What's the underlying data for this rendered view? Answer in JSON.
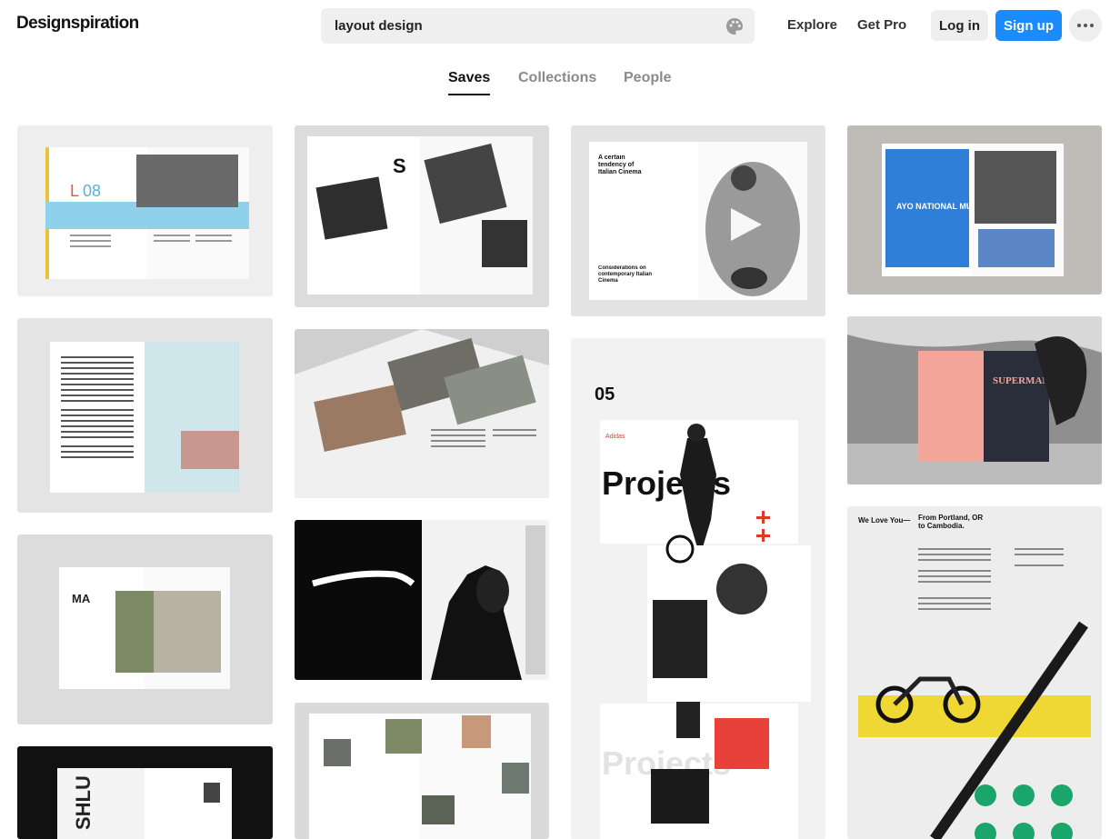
{
  "header": {
    "logo": "Designspiration",
    "search_value": "layout design",
    "nav": {
      "explore": "Explore",
      "get_pro": "Get Pro"
    },
    "login_label": "Log in",
    "signup_label": "Sign up",
    "more_icon": "more-dots-icon",
    "palette_icon": "color-palette-icon"
  },
  "tabs": {
    "saves": "Saves",
    "collections": "Collections",
    "people": "People",
    "active": "Saves"
  },
  "colors": {
    "accent": "#1a8cff",
    "search_bg": "#efefef",
    "button_bg": "#eeeeee"
  },
  "cards": {
    "c2_letter": "S",
    "c3_heading": "A certain tendency of Italian Cinema",
    "c3_footer": "Considerations on contemporary Italian Cinema",
    "c4_title": "AYO NATIONAL MUSIC CAMP",
    "c7_title": "SUPERMAN",
    "c8_num": "05",
    "c8_title": "Projects",
    "c8_ghost": "Projects",
    "c8_brand": "Adidas",
    "c10_left": "We Love You—",
    "c10_right": "From Portland, OR to Cambodia.",
    "c11_code": "MA",
    "c13_word": "SHLU"
  }
}
